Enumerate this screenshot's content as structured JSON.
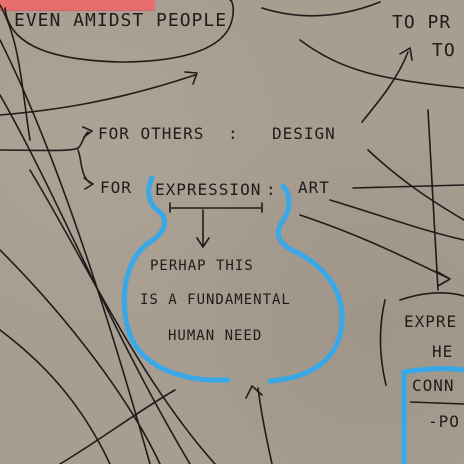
{
  "notes": {
    "top_left": "EVEN AMIDST PEOPLE",
    "top_right_line1": "TO PR",
    "top_right_line2": "TO",
    "for_others": "FOR OTHERS",
    "colon1": ":",
    "design": "DESIGN",
    "for": "FOR",
    "expression": "EXPRESSION",
    "colon2": ":",
    "art": "ART",
    "bubble_line1": "PERHAP THIS",
    "bubble_line2": "IS A FUNDAMENTAL",
    "bubble_line3": "HUMAN NEED",
    "right_line1": "EXPRE",
    "right_line2": "HE",
    "right_line3": "CONN",
    "right_line4": "-PO"
  },
  "colors": {
    "paper": "#a79d90",
    "ink": "#1f1c1a",
    "blue_marker": "#38a8e8",
    "pink_highlight": "#e86d6d"
  }
}
